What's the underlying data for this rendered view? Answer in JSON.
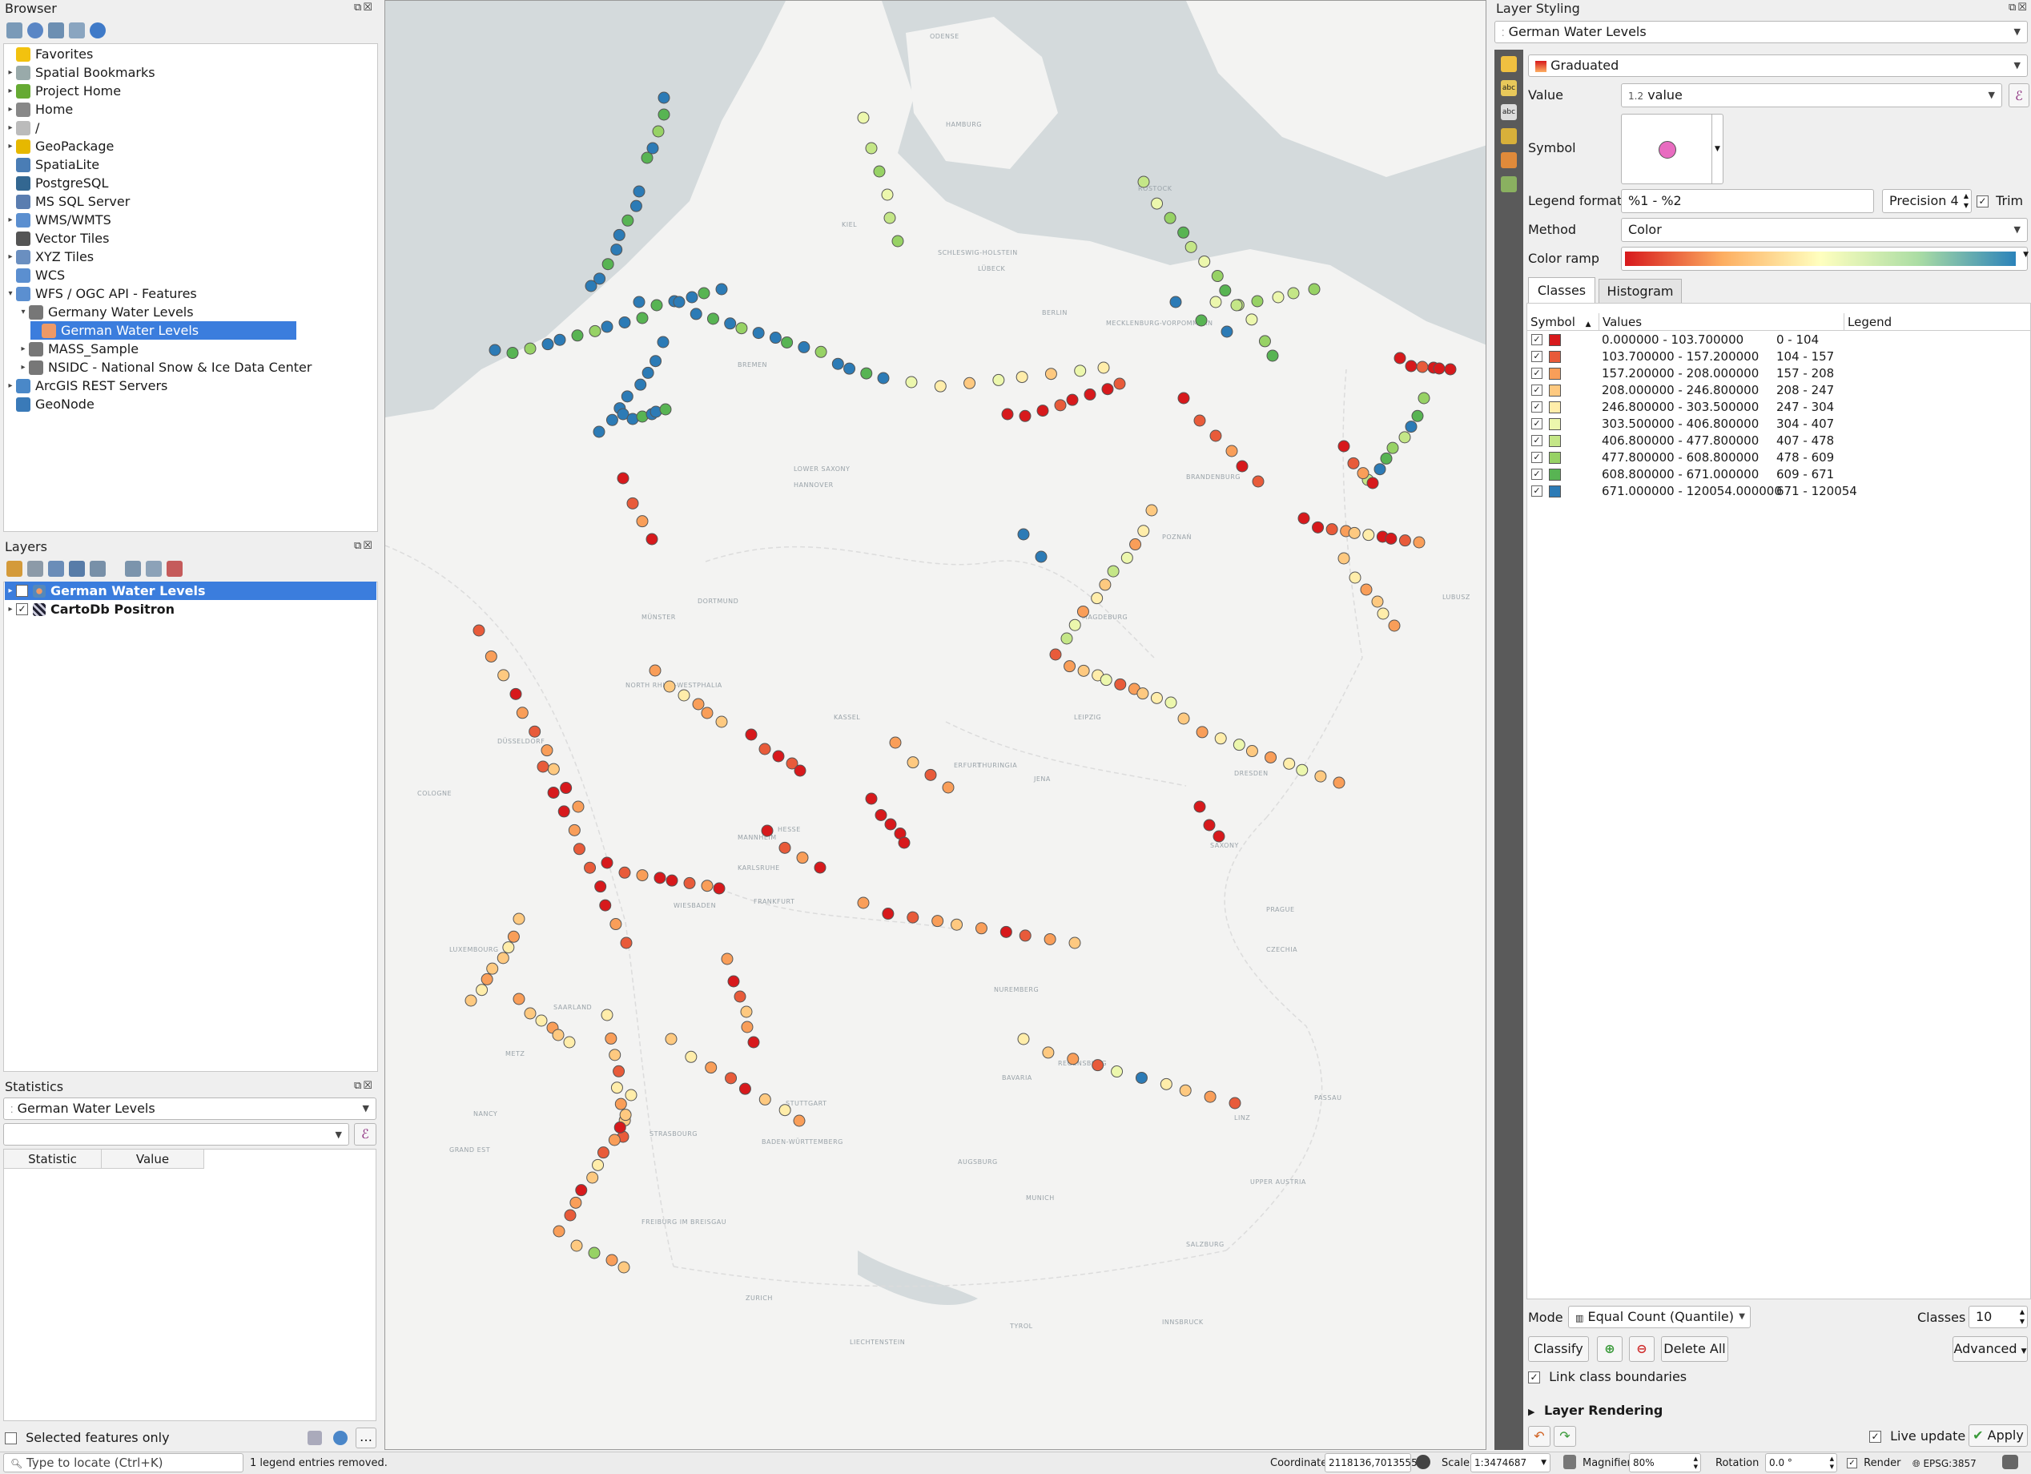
{
  "browser": {
    "title": "Browser",
    "items": [
      {
        "label": "Favorites",
        "icon": "star-icon",
        "indent": 0,
        "expander": ""
      },
      {
        "label": "Spatial Bookmarks",
        "icon": "bookmark-icon",
        "indent": 0,
        "expander": "▸"
      },
      {
        "label": "Project Home",
        "icon": "project-home-icon",
        "indent": 0,
        "expander": "▸"
      },
      {
        "label": "Home",
        "icon": "home-icon",
        "indent": 0,
        "expander": "▸"
      },
      {
        "label": "/",
        "icon": "folder-icon",
        "indent": 0,
        "expander": "▸"
      },
      {
        "label": "GeoPackage",
        "icon": "geopackage-icon",
        "indent": 0,
        "expander": "▸"
      },
      {
        "label": "SpatiaLite",
        "icon": "spatialite-icon",
        "indent": 0,
        "expander": ""
      },
      {
        "label": "PostgreSQL",
        "icon": "postgresql-icon",
        "indent": 0,
        "expander": ""
      },
      {
        "label": "MS SQL Server",
        "icon": "mssql-icon",
        "indent": 0,
        "expander": ""
      },
      {
        "label": "WMS/WMTS",
        "icon": "wms-icon",
        "indent": 0,
        "expander": "▸"
      },
      {
        "label": "Vector Tiles",
        "icon": "vector-tiles-icon",
        "indent": 0,
        "expander": ""
      },
      {
        "label": "XYZ Tiles",
        "icon": "xyz-tiles-icon",
        "indent": 0,
        "expander": "▸"
      },
      {
        "label": "WCS",
        "icon": "wcs-icon",
        "indent": 0,
        "expander": ""
      },
      {
        "label": "WFS / OGC API - Features",
        "icon": "wfs-icon",
        "indent": 0,
        "expander": "▾"
      },
      {
        "label": "Germany Water Levels",
        "icon": "connection-icon",
        "indent": 1,
        "expander": "▾"
      },
      {
        "label": "German Water Levels",
        "icon": "point-layer-icon",
        "indent": 2,
        "expander": "",
        "selected": true
      },
      {
        "label": "MASS_Sample",
        "icon": "connection-icon",
        "indent": 1,
        "expander": "▸"
      },
      {
        "label": "NSIDC - National Snow & Ice Data Center",
        "icon": "connection-icon",
        "indent": 1,
        "expander": "▸"
      },
      {
        "label": "ArcGIS REST Servers",
        "icon": "arcgis-icon",
        "indent": 0,
        "expander": "▸"
      },
      {
        "label": "GeoNode",
        "icon": "geonode-icon",
        "indent": 0,
        "expander": ""
      }
    ]
  },
  "layers": {
    "title": "Layers",
    "items": [
      {
        "label": "German Water Levels",
        "selected": true
      },
      {
        "label": "CartoDb Positron",
        "selected": false
      }
    ]
  },
  "statistics": {
    "title": "Statistics",
    "layer": "German Water Levels",
    "col_statistic": "Statistic",
    "col_value": "Value",
    "selected_only": "Selected features only"
  },
  "styling": {
    "title": "Layer Styling",
    "layer": "German Water Levels",
    "renderer": "Graduated",
    "value_label": "Value",
    "value": "value",
    "value_prefix": "1.2",
    "symbol_label": "Symbol",
    "legend_format_label": "Legend format",
    "legend_format": "%1 - %2",
    "precision": "Precision 4",
    "trim": "Trim",
    "method_label": "Method",
    "method": "Color",
    "color_ramp_label": "Color ramp",
    "tab_classes": "Classes",
    "tab_histogram": "Histogram",
    "col_symbol": "Symbol",
    "col_values": "Values",
    "col_legend": "Legend",
    "classes": [
      {
        "values": "0.000000 - 103.700000",
        "legend": "0 - 104",
        "color": "#d7191c"
      },
      {
        "values": "103.700000 - 157.200000",
        "legend": "104 - 157",
        "color": "#e85b3a"
      },
      {
        "values": "157.200000 - 208.000000",
        "legend": "157 - 208",
        "color": "#f99e59"
      },
      {
        "values": "208.000000 - 246.800000",
        "legend": "208 - 247",
        "color": "#fec980"
      },
      {
        "values": "246.800000 - 303.500000",
        "legend": "247 - 304",
        "color": "#ffedaa"
      },
      {
        "values": "303.500000 - 406.800000",
        "legend": "304 - 407",
        "color": "#ecf7ad"
      },
      {
        "values": "406.800000 - 477.800000",
        "legend": "407 - 478",
        "color": "#c4e687"
      },
      {
        "values": "477.800000 - 608.800000",
        "legend": "478 - 609",
        "color": "#97d265"
      },
      {
        "values": "608.800000 - 671.000000",
        "legend": "609 - 671",
        "color": "#58b453"
      },
      {
        "values": "671.000000 - 120054.000000",
        "legend": "671 - 120054",
        "color": "#2c7bb6"
      }
    ],
    "mode_label": "Mode",
    "mode": "Equal Count (Quantile)",
    "classes_label": "Classes",
    "classes_count": "10",
    "classify": "Classify",
    "delete_all": "Delete All",
    "advanced": "Advanced",
    "link_boundaries": "Link class boundaries",
    "layer_rendering": "Layer Rendering",
    "live_update": "Live update",
    "apply": "Apply"
  },
  "statusbar": {
    "locate_placeholder": "Type to locate (Ctrl+K)",
    "message": "1 legend entries removed.",
    "coordinate_label": "Coordinate",
    "coordinate": "2118136,7013555",
    "scale_label": "Scale",
    "scale": "1:3474687",
    "magnifier_label": "Magnifier",
    "magnifier": "80%",
    "rotation_label": "Rotation",
    "rotation": "0.0 °",
    "render": "Render",
    "crs": "EPSG:3857"
  },
  "map": {
    "place_labels": [
      {
        "t": "BERLIN"
      },
      {
        "t": "HAMBURG"
      },
      {
        "t": "BREMEN"
      },
      {
        "t": "HANNOVER"
      },
      {
        "t": "LEIPZIG"
      },
      {
        "t": "DRESDEN"
      },
      {
        "t": "FRANKFURT"
      },
      {
        "t": "STUTTGART"
      },
      {
        "t": "MUNICH"
      },
      {
        "t": "NUREMBERG"
      },
      {
        "t": "PRAGUE"
      },
      {
        "t": "CZECHIA"
      },
      {
        "t": "LUXEMBOURG"
      },
      {
        "t": "SAXONY"
      },
      {
        "t": "HESSE"
      },
      {
        "t": "BAVARIA"
      },
      {
        "t": "THURINGIA"
      },
      {
        "t": "ZURICH"
      },
      {
        "t": "LIECHTENSTEIN"
      },
      {
        "t": "NORTH RHINE-WESTPHALIA"
      },
      {
        "t": "MECKLENBURG-VORPOMMERN"
      },
      {
        "t": "POZNAŃ"
      },
      {
        "t": "SCHLESWIG-HOLSTEIN"
      },
      {
        "t": "BADEN-WÜRTTEMBERG"
      },
      {
        "t": "BRANDENBURG"
      },
      {
        "t": "LOWER SAXONY"
      },
      {
        "t": "SAARLAND"
      },
      {
        "t": "ODENSE"
      },
      {
        "t": "LUBUSZ"
      },
      {
        "t": "TYROL"
      },
      {
        "t": "SALZBURG"
      },
      {
        "t": "LINZ"
      },
      {
        "t": "UPPER AUSTRIA"
      },
      {
        "t": "GRAND EST"
      },
      {
        "t": "NANCY"
      },
      {
        "t": "METZ"
      },
      {
        "t": "STRASBOURG"
      },
      {
        "t": "FREIBURG IM BREISGAU"
      },
      {
        "t": "KASSEL"
      },
      {
        "t": "MÜNSTER"
      },
      {
        "t": "DORTMUND"
      },
      {
        "t": "DÜSSELDORF"
      },
      {
        "t": "COLOGNE"
      },
      {
        "t": "ERFURT"
      },
      {
        "t": "JENA"
      },
      {
        "t": "KIEL"
      },
      {
        "t": "LÜBECK"
      },
      {
        "t": "ROSTOCK"
      },
      {
        "t": "MAGDEBURG"
      },
      {
        "t": "AUGSBURG"
      },
      {
        "t": "REGENSBURG"
      },
      {
        "t": "KARLSRUHE"
      },
      {
        "t": "MANNHEIM"
      },
      {
        "t": "WIESBADEN"
      },
      {
        "t": "PASSAU"
      },
      {
        "t": "INNSBRUCK"
      }
    ]
  },
  "colors": {
    "accent": "#3b7ddd",
    "water": "#d4dadc",
    "land": "#f3f3f2",
    "sidebar_dark": "#5a5a5a"
  }
}
